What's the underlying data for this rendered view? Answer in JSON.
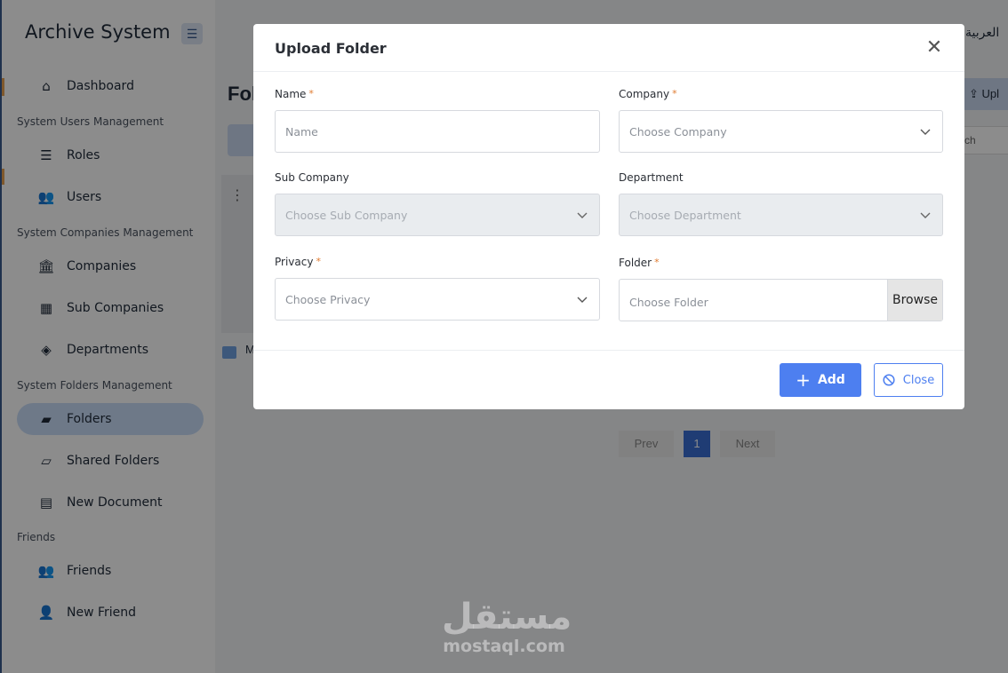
{
  "app": {
    "brand": "Archive System",
    "language": "العربية",
    "page_title": "Fol",
    "upload_partial": "Upl",
    "search_partial": "ch",
    "card_initial": "M"
  },
  "sidebar": {
    "dashboard": "Dashboard",
    "sections": {
      "users_mgmt": "System Users Management",
      "companies_mgmt": "System Companies Management",
      "folders_mgmt": "System Folders Management",
      "friends": "Friends"
    },
    "items": {
      "roles": "Roles",
      "users": "Users",
      "companies": "Companies",
      "sub_companies": "Sub Companies",
      "departments": "Departments",
      "folders": "Folders",
      "shared_folders": "Shared Folders",
      "new_document": "New Document",
      "friends": "Friends",
      "new_friend": "New Friend"
    }
  },
  "pagination": {
    "prev": "Prev",
    "current": "1",
    "next": "Next"
  },
  "modal": {
    "title": "Upload Folder",
    "name": {
      "label": "Name",
      "placeholder": "Name",
      "required": "*"
    },
    "company": {
      "label": "Company",
      "placeholder": "Choose Company",
      "required": "*"
    },
    "sub_company": {
      "label": "Sub Company",
      "placeholder": "Choose Sub Company"
    },
    "department": {
      "label": "Department",
      "placeholder": "Choose Department"
    },
    "privacy": {
      "label": "Privacy",
      "placeholder": "Choose Privacy",
      "required": "*"
    },
    "folder": {
      "label": "Folder",
      "placeholder": "Choose Folder",
      "required": "*",
      "browse": "Browse"
    },
    "add_button": "Add",
    "close_button": "Close"
  },
  "watermark": {
    "arabic": "مستقل",
    "latin": "mostaql.com"
  }
}
